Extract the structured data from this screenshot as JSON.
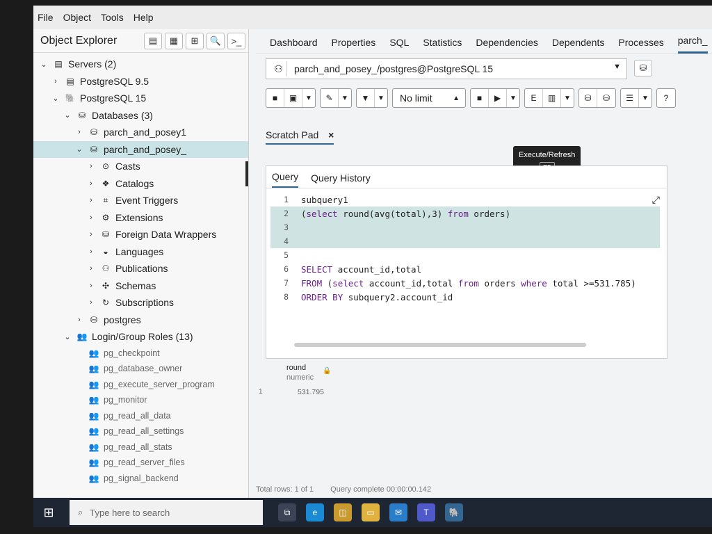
{
  "menu": [
    "File",
    "Object",
    "Tools",
    "Help"
  ],
  "object_explorer": {
    "title": "Object Explorer",
    "tree": [
      {
        "label": "Servers (2)",
        "level": 0,
        "arrow": "open",
        "icon": "server-icon"
      },
      {
        "label": "PostgreSQL 9.5",
        "level": 1,
        "arrow": "closed",
        "icon": "server-error-icon"
      },
      {
        "label": "PostgreSQL 15",
        "level": 1,
        "arrow": "open",
        "icon": "elephant-icon"
      },
      {
        "label": "Databases (3)",
        "level": 2,
        "arrow": "open",
        "icon": "databases-icon"
      },
      {
        "label": "parch_and_posey1",
        "level": 3,
        "arrow": "closed",
        "icon": "database-icon"
      },
      {
        "label": "parch_and_posey_",
        "level": 3,
        "arrow": "open",
        "icon": "database-icon",
        "selected": true
      },
      {
        "label": "Casts",
        "level": 4,
        "arrow": "closed",
        "icon": "casts-icon"
      },
      {
        "label": "Catalogs",
        "level": 4,
        "arrow": "closed",
        "icon": "catalogs-icon"
      },
      {
        "label": "Event Triggers",
        "level": 4,
        "arrow": "closed",
        "icon": "event-triggers-icon"
      },
      {
        "label": "Extensions",
        "level": 4,
        "arrow": "closed",
        "icon": "extensions-icon"
      },
      {
        "label": "Foreign Data Wrappers",
        "level": 4,
        "arrow": "closed",
        "icon": "fdw-icon"
      },
      {
        "label": "Languages",
        "level": 4,
        "arrow": "closed",
        "icon": "languages-icon"
      },
      {
        "label": "Publications",
        "level": 4,
        "arrow": "closed",
        "icon": "publications-icon"
      },
      {
        "label": "Schemas",
        "level": 4,
        "arrow": "closed",
        "icon": "schemas-icon"
      },
      {
        "label": "Subscriptions",
        "level": 4,
        "arrow": "closed",
        "icon": "subscriptions-icon"
      },
      {
        "label": "postgres",
        "level": 3,
        "arrow": "closed",
        "icon": "database-icon"
      },
      {
        "label": "Login/Group Roles (13)",
        "level": 2,
        "arrow": "open",
        "icon": "roles-icon"
      }
    ],
    "roles": [
      "pg_checkpoint",
      "pg_database_owner",
      "pg_execute_server_program",
      "pg_monitor",
      "pg_read_all_data",
      "pg_read_all_settings",
      "pg_read_all_stats",
      "pg_read_server_files",
      "pg_signal_backend"
    ]
  },
  "main_tabs": [
    "Dashboard",
    "Properties",
    "SQL",
    "Statistics",
    "Dependencies",
    "Dependents",
    "Processes",
    "parch_"
  ],
  "connection": "parch_and_posey_/postgres@PostgreSQL 15",
  "toolbar": {
    "limit": "No limit"
  },
  "tooltip": {
    "title": "Execute/Refresh",
    "key": "F5"
  },
  "scratch_pad": {
    "label": "Scratch Pad",
    "close": "×"
  },
  "query_tabs": {
    "query": "Query",
    "history": "Query History"
  },
  "code_lines": [
    {
      "n": "1",
      "text": "subquery1"
    },
    {
      "n": "2",
      "text": "(select round(avg(total),3) from orders)"
    },
    {
      "n": "3",
      "text": ""
    },
    {
      "n": "4",
      "text": ""
    },
    {
      "n": "5",
      "text": ""
    },
    {
      "n": "6",
      "text": "SELECT account_id,total"
    },
    {
      "n": "7",
      "text": "FROM (select account_id,total from orders where total >=531.785)"
    },
    {
      "n": "8",
      "text": "ORDER BY subquery2.account_id"
    }
  ],
  "result": {
    "column": "round",
    "type": "numeric",
    "row_number": "1",
    "value": "531.795"
  },
  "status": {
    "rows": "Total rows: 1 of 1",
    "complete": "Query complete 00:00:00.142"
  },
  "taskbar": {
    "search_placeholder": "Type here to search"
  },
  "colors": {
    "accent": "#326690",
    "selected": "#c9e3e6",
    "highlight_line": "#cfe3e3",
    "keyword": "#6b1f8a"
  }
}
